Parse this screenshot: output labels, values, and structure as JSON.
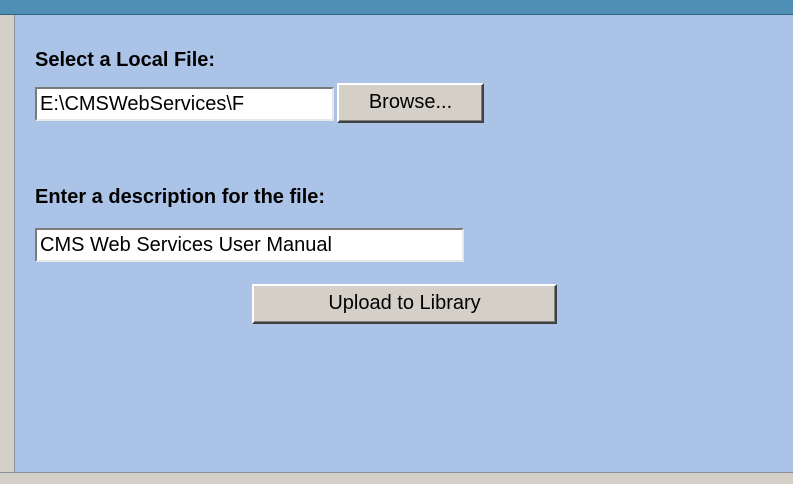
{
  "form": {
    "local_file_label": "Select a Local File:",
    "local_file_value": "E:\\CMSWebServices\\F",
    "browse_label": "Browse...",
    "description_label": "Enter a description for the file:",
    "description_value": "CMS Web Services User  Manual",
    "upload_label": "Upload to Library"
  },
  "colors": {
    "panel_background": "#abc3e6",
    "top_strip": "#4f8fb6",
    "button_face": "#d4d0c8"
  }
}
